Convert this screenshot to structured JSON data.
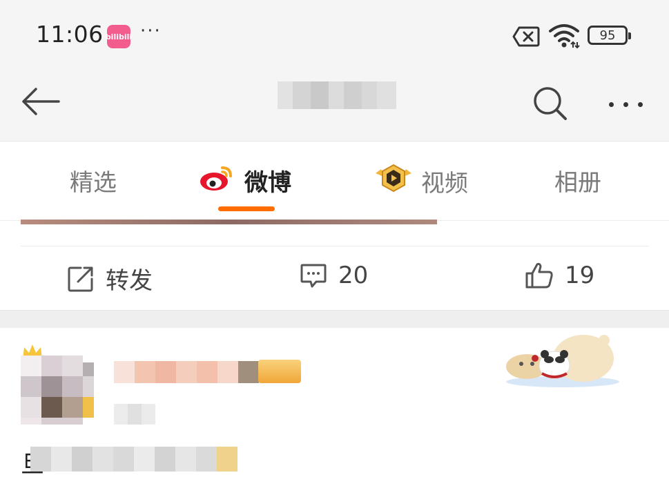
{
  "status_bar": {
    "time": "11:06",
    "app_badge": "bilibili",
    "dots": "···",
    "battery": "95"
  },
  "nav": {
    "title": ""
  },
  "tabs": [
    {
      "label": "精选",
      "active": false
    },
    {
      "label": "微博",
      "active": true
    },
    {
      "label": "视频",
      "active": false
    },
    {
      "label": "相册",
      "active": false
    }
  ],
  "actions": {
    "share_label": "转发",
    "comment_count": "20",
    "like_count": "19"
  },
  "post": {
    "text_first_char": "旦"
  },
  "colors": {
    "accent": "#ff6d00",
    "background": "#f5f5f5"
  }
}
